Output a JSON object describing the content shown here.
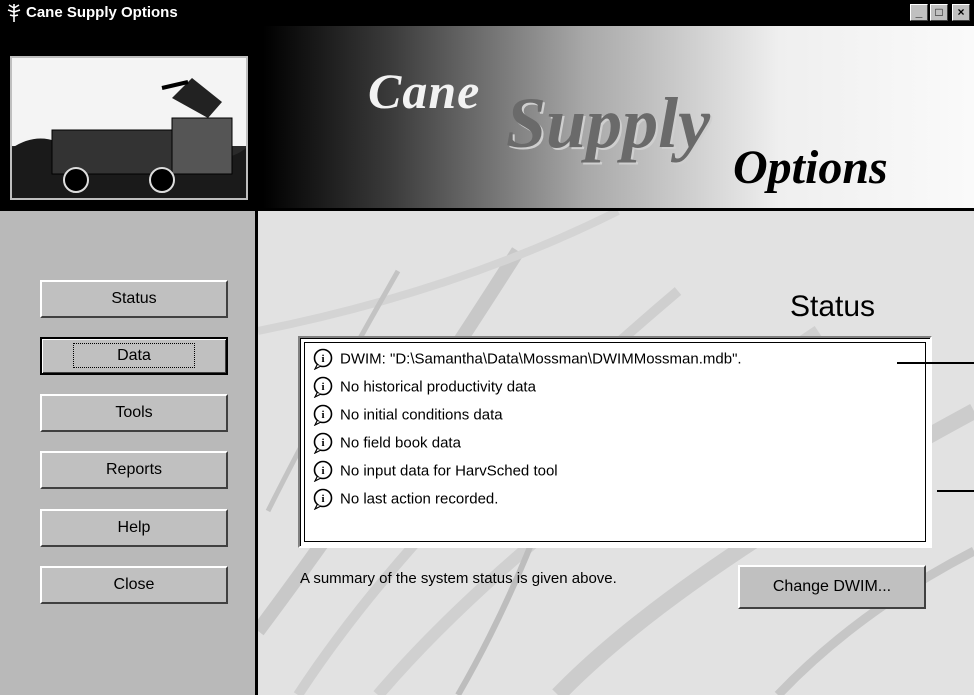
{
  "window": {
    "title": "Cane Supply Options",
    "controls": {
      "minimize": "_",
      "maximize": "□",
      "close": "×"
    }
  },
  "banner": {
    "word1": "Cane",
    "word2": "Supply",
    "word3": "Options"
  },
  "nav": {
    "items": [
      {
        "label": "Status",
        "mnemonic": "S"
      },
      {
        "label": "Data",
        "mnemonic": "D",
        "focused": true
      },
      {
        "label": "Tools",
        "mnemonic": "T"
      },
      {
        "label": "Reports",
        "mnemonic": "R"
      },
      {
        "label": "Help",
        "mnemonic": "H"
      },
      {
        "label": "Close",
        "mnemonic": "C"
      }
    ]
  },
  "main": {
    "heading": "Status",
    "status_items": [
      "DWIM: \"D:\\Samantha\\Data\\Mossman\\DWIMMossman.mdb\".",
      "No historical productivity data",
      "No initial conditions data",
      "No field book data",
      "No input data for HarvSched tool",
      "No last action recorded."
    ],
    "summary": "A summary of the system status is given above.",
    "change_button": "Change DWIM..."
  },
  "colors": {
    "window_bg": "#c0c0c0",
    "titlebar": "#000000",
    "list_bg": "#ffffff"
  }
}
